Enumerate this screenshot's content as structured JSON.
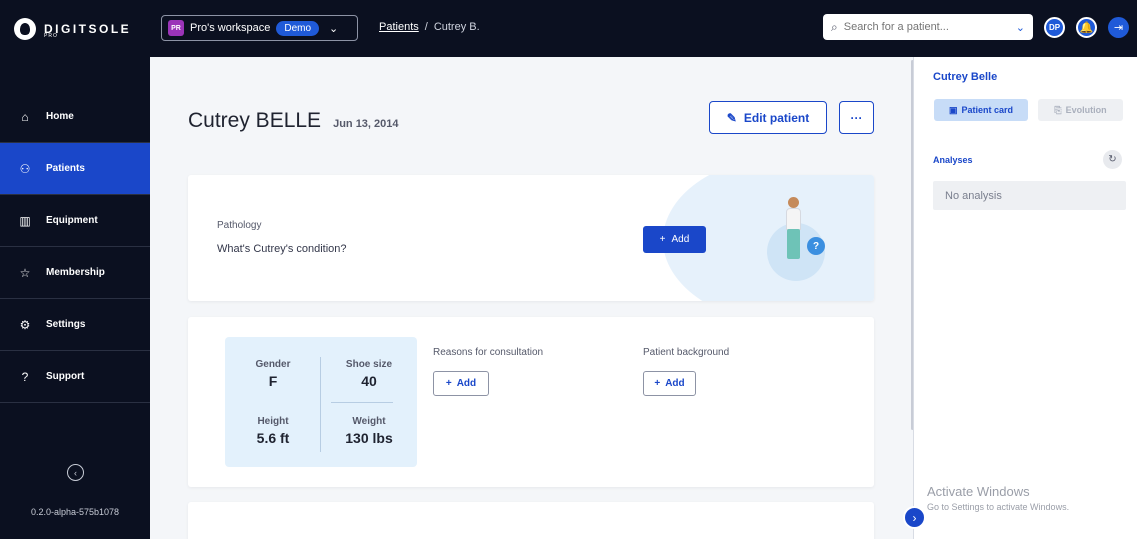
{
  "brand": {
    "name": "DIGITSOLE",
    "sub": "PRO"
  },
  "workspace": {
    "badge": "PR",
    "name": "Pro's workspace",
    "tag": "Demo"
  },
  "breadcrumb": {
    "root": "Patients",
    "separator": "/",
    "current": "Cutrey B."
  },
  "search": {
    "placeholder": "Search for a patient..."
  },
  "user": {
    "initials": "DP"
  },
  "sidebar": {
    "items": [
      {
        "label": "Home",
        "icon": "home-icon",
        "glyph": "⌂",
        "active": false
      },
      {
        "label": "Patients",
        "icon": "people-icon",
        "glyph": "⚇",
        "active": true
      },
      {
        "label": "Equipment",
        "icon": "toolbox-icon",
        "glyph": "▥",
        "active": false
      },
      {
        "label": "Membership",
        "icon": "star-icon",
        "glyph": "☆",
        "active": false
      },
      {
        "label": "Settings",
        "icon": "gear-icon",
        "glyph": "⚙",
        "active": false
      },
      {
        "label": "Support",
        "icon": "help-icon",
        "glyph": "?",
        "active": false
      }
    ],
    "version": "0.2.0-alpha-575b1078"
  },
  "patient": {
    "name": "Cutrey BELLE",
    "birthdate": "Jun 13, 2014",
    "edit_label": "Edit patient",
    "more_label": "···"
  },
  "pathology": {
    "label": "Pathology",
    "question": "What's Cutrey's condition?",
    "add_label": "Add"
  },
  "stats": {
    "gender": {
      "label": "Gender",
      "value": "F"
    },
    "shoe_size": {
      "label": "Shoe size",
      "value": "40"
    },
    "height": {
      "label": "Height",
      "value": "5.6 ft"
    },
    "weight": {
      "label": "Weight",
      "value": "130 lbs"
    }
  },
  "reasons": {
    "label": "Reasons for consultation",
    "add_label": "Add"
  },
  "background": {
    "label": "Patient background",
    "add_label": "Add"
  },
  "panel": {
    "title": "Cutrey Belle",
    "tabs": [
      {
        "label": "Patient card",
        "active": true
      },
      {
        "label": "Evolution",
        "active": false
      }
    ],
    "analyses_label": "Analyses",
    "no_analysis": "No analysis"
  },
  "watermark": {
    "title": "Activate Windows",
    "subtitle": "Go to Settings to activate Windows."
  },
  "colors": {
    "accent": "#1a47c9",
    "topbar": "#0b1020",
    "light_blue": "#e3f1fc"
  }
}
